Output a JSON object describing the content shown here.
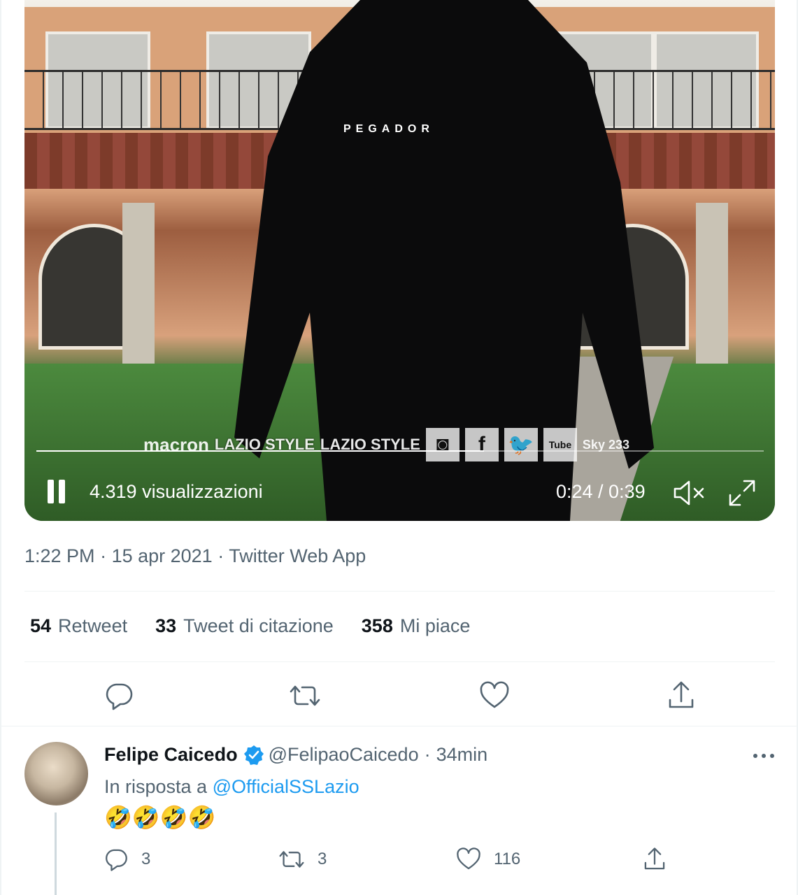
{
  "video": {
    "views": "4.319 visualizzazioni",
    "time": "0:24 / 0:39",
    "progress": 0.615,
    "hoodie_brand": "PEGADOR",
    "overlay_brands": [
      "macron",
      "LAZIO STYLE",
      "LAZIO STYLE",
      "Sky 233"
    ]
  },
  "tweet": {
    "time": "1:22 PM",
    "date": "15 apr 2021",
    "source": "Twitter Web App",
    "stats": [
      {
        "count": "54",
        "label": "Retweet"
      },
      {
        "count": "33",
        "label": "Tweet di citazione"
      },
      {
        "count": "358",
        "label": "Mi piace"
      }
    ]
  },
  "reply": {
    "name": "Felipe Caicedo",
    "handle": "@FelipaoCaicedo",
    "time": "34min",
    "in_reply_prefix": "In risposta a",
    "in_reply_handle": "@OfficialSSLazio",
    "text": "🤣🤣🤣🤣",
    "replies": "3",
    "retweets": "3",
    "likes": "116"
  },
  "colors": {
    "accent": "#1d9bf0",
    "secondary_text": "#536471",
    "primary_text": "#0f1419"
  },
  "icons": [
    "pause-icon",
    "mute-icon",
    "expand-icon",
    "reply-icon",
    "retweet-icon",
    "like-icon",
    "share-icon",
    "verified-icon",
    "more-icon"
  ]
}
